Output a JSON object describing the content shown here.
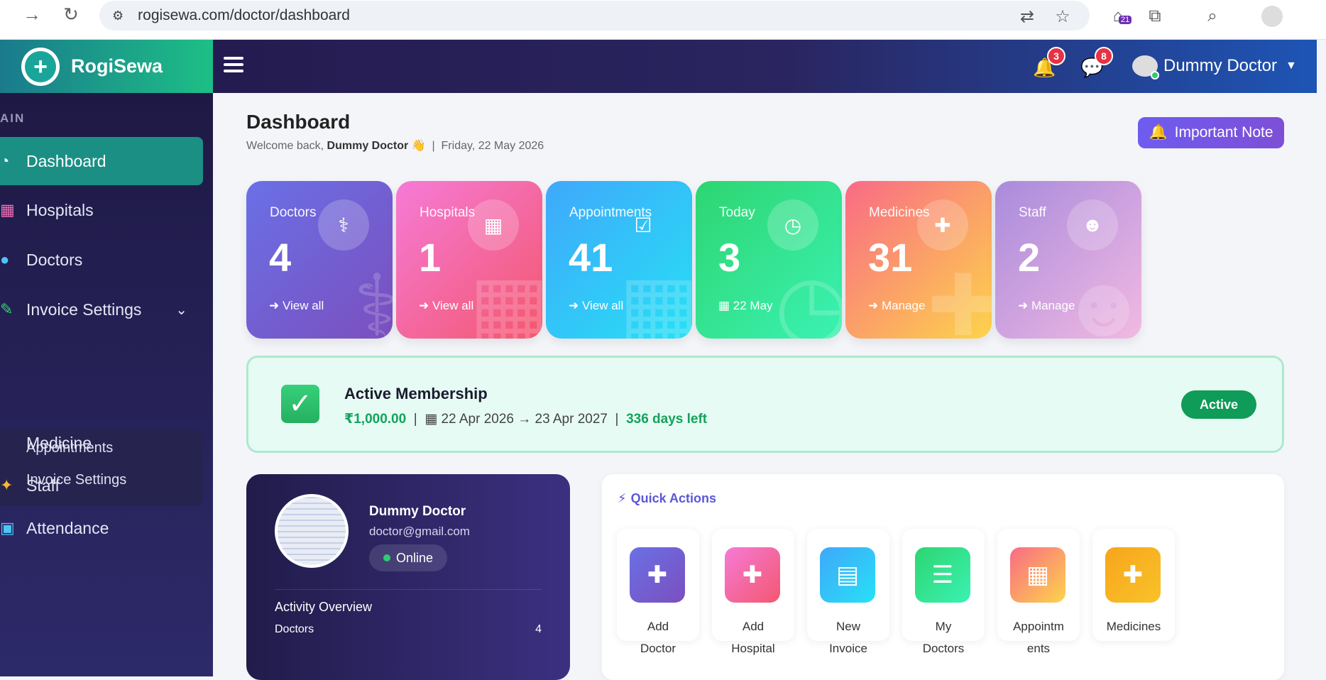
{
  "browser": {
    "url": "rogisewa.com/doctor/dashboard",
    "ext_badge": "21"
  },
  "header": {
    "brand": "RogiSewa",
    "notif_count": "3",
    "msg_count": "8",
    "user_name": "Dummy Doctor"
  },
  "sidebar": {
    "section": "AIN",
    "items": [
      {
        "label": "Dashboard",
        "icon": "dashboard-icon"
      },
      {
        "label": "Hospitals",
        "icon": "hospital-icon"
      },
      {
        "label": "Doctors",
        "icon": "doctor-icon"
      },
      {
        "label": "Invoice Settings",
        "icon": "invoice-icon"
      },
      {
        "label": "Medicine",
        "icon": ""
      },
      {
        "label": "Staff",
        "icon": "staff-icon"
      },
      {
        "label": "Attendance",
        "icon": "attendance-icon"
      }
    ],
    "submenu": [
      "Appointments",
      "Invoice Settings"
    ]
  },
  "page": {
    "title": "Dashboard",
    "welcome_prefix": "Welcome back,",
    "welcome_name": "Dummy Doctor",
    "welcome_emoji": "👋",
    "date": "Friday, 22 May 2026",
    "note_button": "Important Note"
  },
  "stats": [
    {
      "label": "Doctors",
      "value": "4",
      "link": "View all",
      "gradient": [
        "#6a70e6",
        "#7b4fbe"
      ]
    },
    {
      "label": "Hospitals",
      "value": "1",
      "link": "View all",
      "gradient": [
        "#f57bd6",
        "#f4576f"
      ]
    },
    {
      "label": "Appointments",
      "value": "41",
      "link": "View all",
      "gradient": [
        "#3fa8fb",
        "#27e0f5"
      ]
    },
    {
      "label": "Today",
      "value": "3",
      "link": "22 May",
      "gradient": [
        "#2ed571",
        "#3af2b2"
      ]
    },
    {
      "label": "Medicines",
      "value": "31",
      "link": "Manage",
      "gradient": [
        "#f96a86",
        "#fdd44b"
      ]
    },
    {
      "label": "Staff",
      "value": "2",
      "link": "Manage",
      "gradient": [
        "#a98bdc",
        "#f2b9e2"
      ]
    }
  ],
  "membership": {
    "title": "Active Membership",
    "amount": "₹1,000.00",
    "period": "22 Apr 2026 → 23 Apr 2027",
    "days_left": "336 days left",
    "status": "Active"
  },
  "profile": {
    "name": "Dummy Doctor",
    "email": "doctor@gmail.com",
    "status": "Online",
    "activity_title": "Activity Overview",
    "activity_label": "Doctors",
    "activity_value": "4"
  },
  "quick_actions": {
    "title": "Quick Actions",
    "items": [
      {
        "label": "Add Doctor",
        "color": [
          "#6a70e6",
          "#7b4fbe"
        ]
      },
      {
        "label": "Add Hospital",
        "color": [
          "#f57bd6",
          "#f4576f"
        ]
      },
      {
        "label": "New Invoice",
        "color": [
          "#3fa8fb",
          "#27e0f5"
        ]
      },
      {
        "label": "My Doctors",
        "color": [
          "#2ed571",
          "#3af2b2"
        ]
      },
      {
        "label": "Appointm ents",
        "color": [
          "#f96a86",
          "#fdd44b"
        ]
      },
      {
        "label": "Medicines",
        "color": [
          "#f7a51c",
          "#f9c22a"
        ]
      }
    ]
  }
}
